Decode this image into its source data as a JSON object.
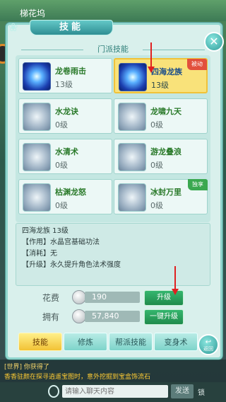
{
  "header": {
    "bg_title": "梯花坞",
    "panel_title": "技能",
    "section_title": "门派技能"
  },
  "skills": [
    {
      "name": "龙卷雨击",
      "level": "13级",
      "state": "active",
      "badge": ""
    },
    {
      "name": "四海龙族",
      "level": "13级",
      "state": "active",
      "badge": "被动",
      "selected": true
    },
    {
      "name": "水龙诀",
      "level": "0级",
      "state": "locked",
      "badge": ""
    },
    {
      "name": "龙啸九天",
      "level": "0级",
      "state": "locked",
      "badge": ""
    },
    {
      "name": "水清术",
      "level": "0级",
      "state": "locked",
      "badge": ""
    },
    {
      "name": "游龙叠浪",
      "level": "0级",
      "state": "locked",
      "badge": ""
    },
    {
      "name": "枯渊龙怒",
      "level": "0级",
      "state": "locked",
      "badge": ""
    },
    {
      "name": "冰封万里",
      "level": "0级",
      "state": "locked",
      "badge": "独享"
    }
  ],
  "description": {
    "line1": "四海龙族  13级",
    "line2": "【作用】水晶宫基础功法",
    "line3": "【消耗】无",
    "line4": "【升级】永久提升角色法术强度"
  },
  "cost": {
    "label": "花费",
    "value": "190",
    "button": "升级"
  },
  "owned": {
    "label": "拥有",
    "value": "57,840",
    "button": "一键升级"
  },
  "tabs": [
    {
      "label": "技能",
      "active": true
    },
    {
      "label": "修炼"
    },
    {
      "label": "帮派技能"
    },
    {
      "label": "变身术"
    }
  ],
  "back_label": "返回",
  "chat": {
    "line1": "[世界]  你获得了",
    "line2": "香香驻颜在探寻逍遥宝图时，意外挖掘到宝盒饰流石",
    "placeholder": "请输入聊天内容",
    "send": "发送",
    "lock": "锁"
  },
  "colors": {
    "accent": "#2f8e93",
    "selected": "#f9e27a",
    "upgrade": "#1f8b4c",
    "arrow": "#e02020"
  }
}
